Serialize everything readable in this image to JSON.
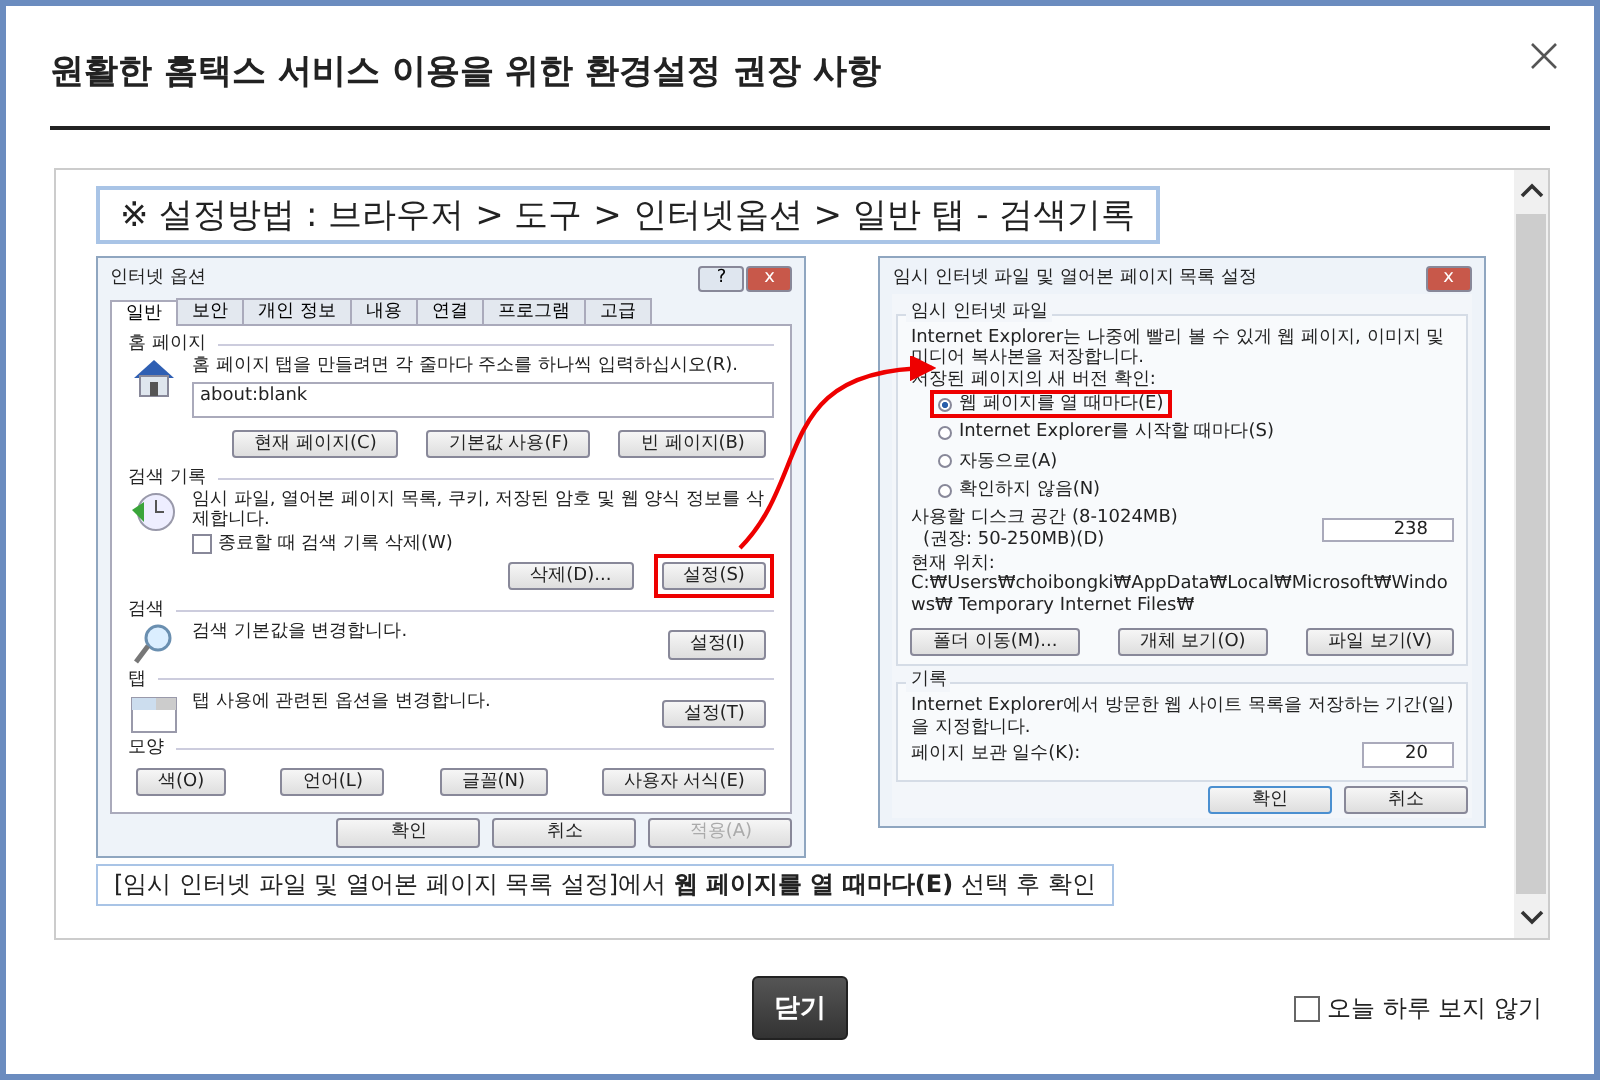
{
  "dialog": {
    "title": "원활한 홈택스 서비스 이용을 위한 환경설정 권장 사항"
  },
  "guide_banner": "※ 설정방법 : 브라우저 > 도구 > 인터넷옵션 > 일반 탭 - 검색기록",
  "internet_options": {
    "title": "인터넷 옵션",
    "title_buttons": [
      "?",
      "x"
    ],
    "tabs": [
      {
        "label": "일반",
        "selected": true
      },
      {
        "label": "보안",
        "selected": false
      },
      {
        "label": "개인 정보",
        "selected": false
      },
      {
        "label": "내용",
        "selected": false
      },
      {
        "label": "연결",
        "selected": false
      },
      {
        "label": "프로그램",
        "selected": false
      },
      {
        "label": "고급",
        "selected": false
      }
    ],
    "sections": [
      {
        "kind": "home",
        "heading": "홈 페이지",
        "text": "홈 페이지 탭을 만들려면 각 줄마다 주소를 하나씩 입력하십시오(R).",
        "field_value": "about:blank",
        "buttons": [
          {
            "label": "현재 페이지(C)",
            "highlighted": false
          },
          {
            "label": "기본값 사용(F)",
            "highlighted": false
          },
          {
            "label": "빈 페이지(B)",
            "highlighted": false
          }
        ]
      },
      {
        "kind": "history",
        "heading": "검색 기록",
        "text": "임시 파일, 열어본 페이지 목록, 쿠키, 저장된 암호 및 웹 양식 정보를 삭제합니다.",
        "checkbox": {
          "label": "종료할 때 검색 기록 삭제(W)",
          "checked": false
        },
        "buttons": [
          {
            "label": "삭제(D)...",
            "highlighted": false
          },
          {
            "label": "설정(S)",
            "highlighted": true
          }
        ]
      },
      {
        "kind": "search",
        "heading": "검색",
        "text": "검색 기본값을 변경합니다.",
        "buttons": [
          {
            "label": "설정(I)",
            "highlighted": false
          }
        ]
      },
      {
        "kind": "tabs",
        "heading": "탭",
        "text": "탭 사용에 관련된 옵션을 변경합니다.",
        "buttons": [
          {
            "label": "설정(T)",
            "highlighted": false
          }
        ]
      },
      {
        "kind": "appearance",
        "heading": "모양",
        "buttons": [
          {
            "label": "색(O)",
            "highlighted": false
          },
          {
            "label": "언어(L)",
            "highlighted": false
          },
          {
            "label": "글꼴(N)",
            "highlighted": false
          },
          {
            "label": "사용자 서식(E)",
            "highlighted": false
          }
        ]
      }
    ],
    "footer_buttons": [
      {
        "label": "확인",
        "disabled": false
      },
      {
        "label": "취소",
        "disabled": false
      },
      {
        "label": "적용(A)",
        "disabled": true
      }
    ]
  },
  "cache_settings": {
    "title": "임시 인터넷 파일 및 열어본 페이지 목록 설정",
    "close": "x",
    "temp_files": {
      "legend": "임시 인터넷 파일",
      "text": "Internet Explorer는 나중에 빨리 볼 수 있게 웹 페이지, 이미지 및 미디어 복사본을 저장합니다.",
      "options_label": "저장된 페이지의 새 버전 확인:",
      "options": [
        {
          "label": "웹 페이지를 열 때마다(E)",
          "selected": true,
          "highlighted": true
        },
        {
          "label": "Internet Explorer를 시작할 때마다(S)",
          "selected": false,
          "highlighted": false
        },
        {
          "label": "자동으로(A)",
          "selected": false,
          "highlighted": false
        },
        {
          "label": "확인하지 않음(N)",
          "selected": false,
          "highlighted": false
        }
      ],
      "disk_label": "사용할 디스크 공간 (8-1024MB)",
      "disk_hint": "(권장: 50-250MB)(D)",
      "disk_value": "238",
      "location_label": "현재 위치:",
      "location_path": "C:₩Users₩choibongki₩AppData₩Local₩Microsoft₩Windows₩ Temporary Internet Files₩",
      "buttons": [
        "폴더 이동(M)...",
        "개체 보기(O)",
        "파일 보기(V)"
      ]
    },
    "history": {
      "legend": "기록",
      "text": "Internet Explorer에서 방문한 웹 사이트 목록을 저장하는 기간(일)을 지정합니다.",
      "days_label": "페이지 보관 일수(K):",
      "days_value": "20"
    },
    "footer_buttons": [
      "확인",
      "취소"
    ]
  },
  "caption": "[임시 인터넷 파일 및 열어본 페이지 목록 설정]에서 **웹 페이지를 열 때마다(E)** 선택 후 확인",
  "footer": {
    "close_button": "닫기",
    "checkbox": {
      "label": "오늘 하루 보지 않기",
      "checked": false
    }
  }
}
